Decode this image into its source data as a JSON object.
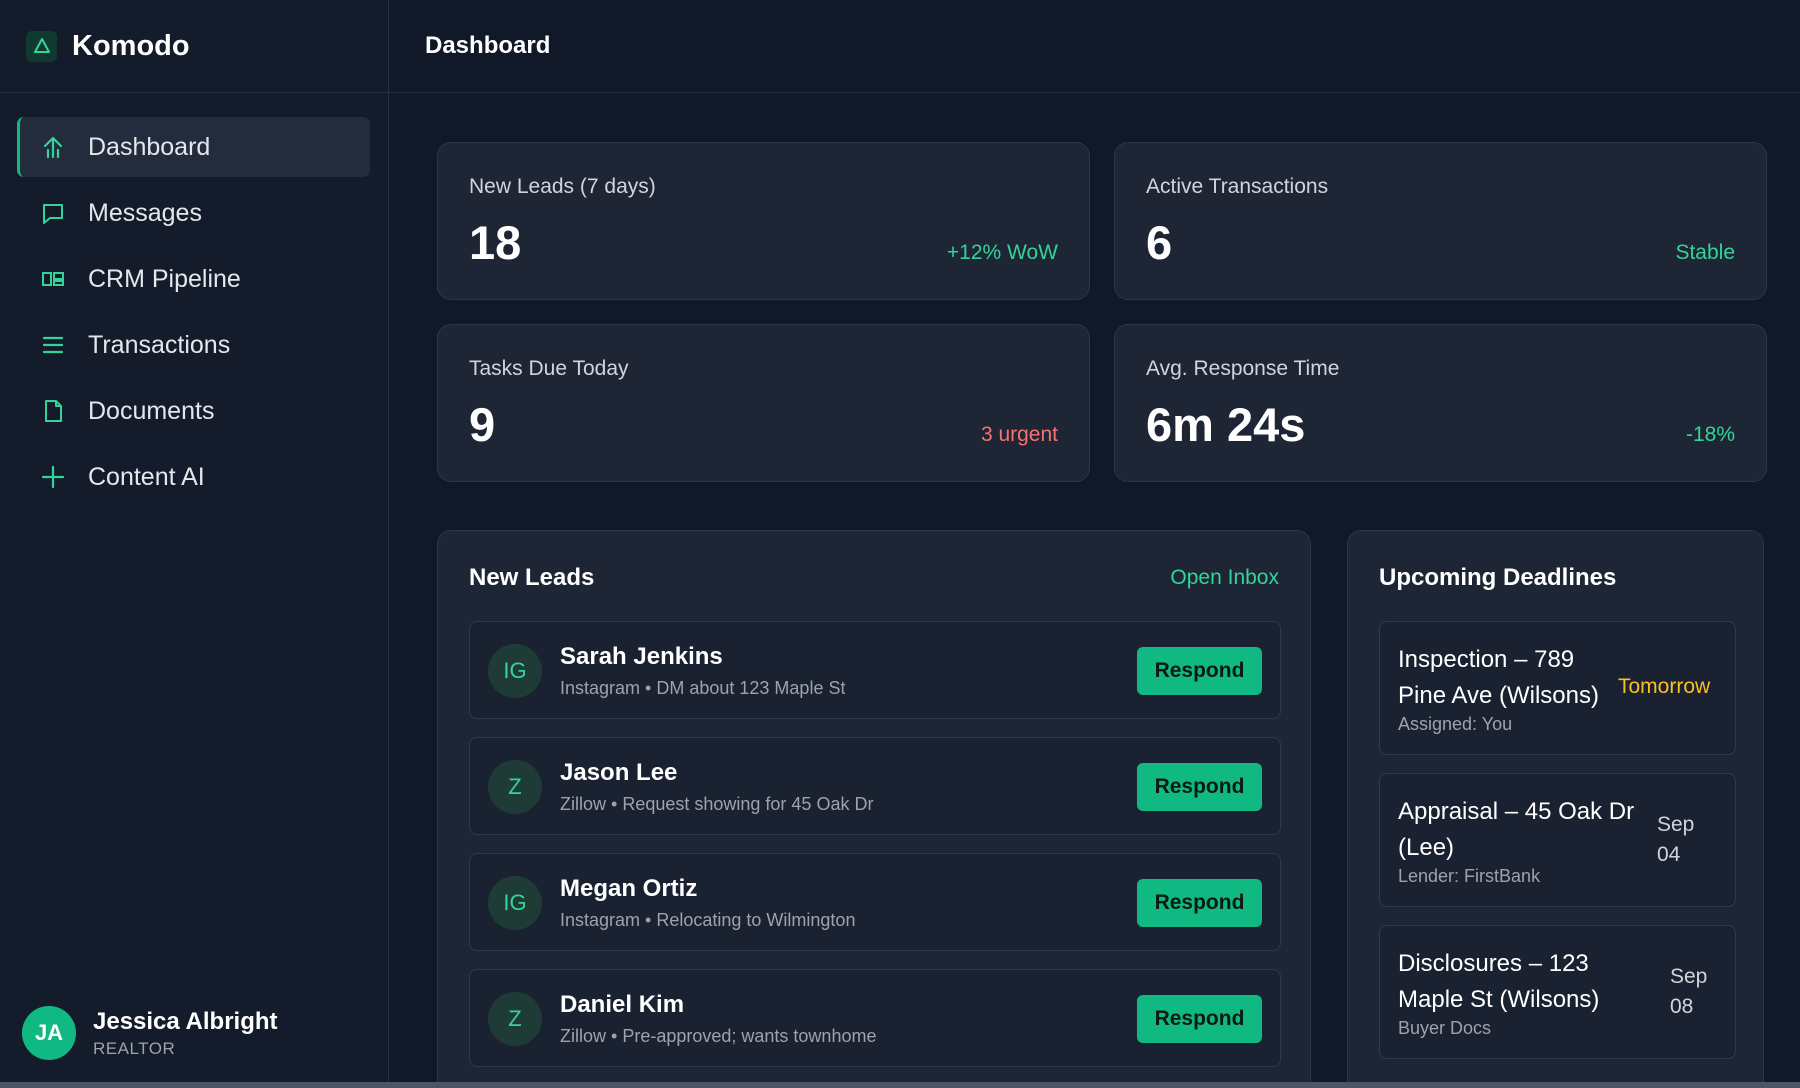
{
  "app": {
    "name": "Komodo",
    "logo_icon": "triangle-logo-icon",
    "accent": "#10b981"
  },
  "sidebar": {
    "items": [
      {
        "label": "Dashboard",
        "icon": "arrow-up-icon",
        "active": true
      },
      {
        "label": "Messages",
        "icon": "chat-bubble-icon"
      },
      {
        "label": "CRM Pipeline",
        "icon": "kanban-icon"
      },
      {
        "label": "Transactions",
        "icon": "list-icon"
      },
      {
        "label": "Documents",
        "icon": "document-icon"
      },
      {
        "label": "Content AI",
        "icon": "plus-icon"
      }
    ],
    "user": {
      "initials": "JA",
      "name": "Jessica Albright",
      "role": "REALTOR"
    }
  },
  "header": {
    "title": "Dashboard"
  },
  "stats": [
    {
      "label": "New Leads (7 days)",
      "value": "18",
      "delta": "+12% WoW",
      "tone": "positive"
    },
    {
      "label": "Active Transactions",
      "value": "6",
      "delta": "Stable",
      "tone": "positive"
    },
    {
      "label": "Tasks Due Today",
      "value": "9",
      "delta": "3 urgent",
      "tone": "negative"
    },
    {
      "label": "Avg. Response Time",
      "value": "6m 24s",
      "delta": "-18%",
      "tone": "positive"
    }
  ],
  "leads": {
    "title": "New Leads",
    "link": "Open Inbox",
    "button_label": "Respond",
    "items": [
      {
        "initials": "IG",
        "name": "Sarah Jenkins",
        "source": "Instagram",
        "note": "DM about 123 Maple St"
      },
      {
        "initials": "Z",
        "name": "Jason Lee",
        "source": "Zillow",
        "note": "Request showing for 45 Oak Dr"
      },
      {
        "initials": "IG",
        "name": "Megan Ortiz",
        "source": "Instagram",
        "note": "Relocating to Wilmington"
      },
      {
        "initials": "Z",
        "name": "Daniel Kim",
        "source": "Zillow",
        "note": "Pre-approved; wants townhome"
      }
    ]
  },
  "deadlines": {
    "title": "Upcoming Deadlines",
    "items": [
      {
        "title_line1": "Inspection – 789",
        "title_line2": "Pine Ave (Wilsons)",
        "sub": "Assigned: You",
        "date": "Tomorrow",
        "date_line2": ""
      },
      {
        "title_line1": "Appraisal – 45 Oak Dr",
        "title_line2": "(Lee)",
        "sub": "Lender: FirstBank",
        "date": "Sep",
        "date_line2": "04"
      },
      {
        "title_line1": "Disclosures – 123",
        "title_line2": "Maple St (Wilsons)",
        "sub": "Buyer Docs",
        "date": "Sep",
        "date_line2": "08"
      }
    ]
  }
}
